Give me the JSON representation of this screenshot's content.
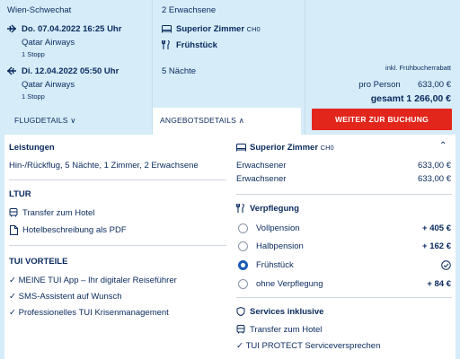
{
  "flight": {
    "origin": "Wien-Schwechat",
    "outbound_date": "Do. 07.04.2022 16:25 Uhr",
    "outbound_airline": "Qatar Airways",
    "outbound_stops": "1 Stopp",
    "return_date": "Di. 12.04.2022 05:50 Uhr",
    "return_airline": "Qatar Airways",
    "return_stops": "1 Stopp",
    "details_link": "FLUGDETAILS"
  },
  "offer": {
    "travelers": "2 Erwachsene",
    "room": "Superior Zimmer",
    "room_code": "CH0",
    "board": "Frühstück",
    "nights": "5 Nächte",
    "details_link": "ANGEBOTSDETAILS"
  },
  "price": {
    "note": "inkl. Frühbucherrabatt",
    "per_person_label": "pro Person",
    "per_person_value": "633,00 €",
    "total": "gesamt 1 266,00 €",
    "cta_label": "WEITER ZUR BUCHUNG"
  },
  "left": {
    "services_heading": "Leistungen",
    "services_text": "Hin-/Rückflug, 5 Nächte, 1 Zimmer, 2 Erwachsene",
    "ltur_heading": "LTUR",
    "ltur_items": [
      "Transfer zum Hotel",
      "Hotelbeschreibung als PDF"
    ],
    "tui_heading": "TUI VORTEILE",
    "tui_items": [
      "MEINE TUI App – Ihr digitaler Reiseführer",
      "SMS-Assistent auf Wunsch",
      "Professionelles TUI Krisenmanagement"
    ]
  },
  "right": {
    "room_title": "Superior Zimmer",
    "room_code": "CH0",
    "rows": [
      {
        "label": "Erwachsener",
        "value": "633,00 €"
      },
      {
        "label": "Erwachsener",
        "value": "633,00 €"
      }
    ],
    "board_heading": "Verpflegung",
    "board_options": [
      {
        "label": "Vollpension",
        "price": "+ 405 €",
        "selected": false
      },
      {
        "label": "Halbpension",
        "price": "+ 162 €",
        "selected": false
      },
      {
        "label": "Frühstück",
        "price": "",
        "selected": true
      },
      {
        "label": "ohne Verpflegung",
        "price": "+ 84 €",
        "selected": false
      }
    ],
    "services_heading": "Services inklusive",
    "services_items": [
      "Transfer zum Hotel",
      "TUI PROTECT Serviceversprechen"
    ]
  },
  "colors": {
    "accent": "#e2261c",
    "brand": "#092a5e",
    "radio": "#1a5bb6",
    "panel_bg": "#d6ecf8"
  }
}
